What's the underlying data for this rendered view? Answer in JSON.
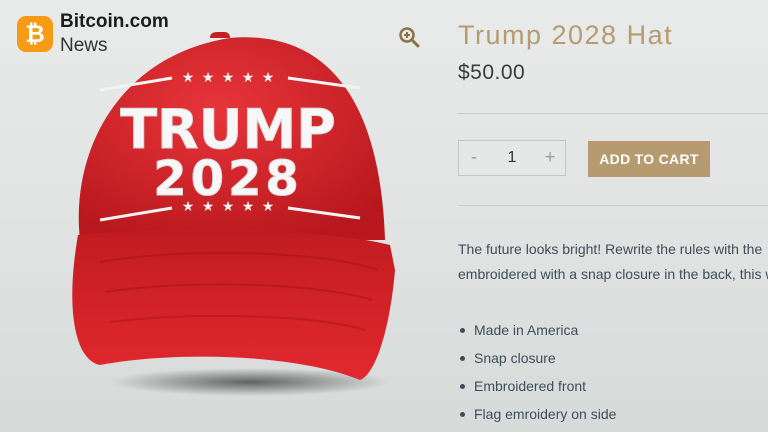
{
  "brand": {
    "icon": "bitcoin-icon",
    "glyph": "₿",
    "name": "Bitcoin.com",
    "sub": "News"
  },
  "product": {
    "title": "Trump 2028 Hat",
    "price": "$50.00",
    "hat_text_line1": "TRUMP",
    "hat_text_line2": "2028",
    "quantity": "1",
    "qty_minus": "-",
    "qty_plus": "+",
    "add_to_cart": "ADD TO CART",
    "description_lines": [
      "The future looks bright! Rewrite the rules with the",
      "embroidered with a snap closure in the back, this w"
    ],
    "features": [
      "Made in America",
      "Snap closure",
      "Embroidered front",
      "Flag emroidery on side"
    ]
  },
  "colors": {
    "accent": "#b59b6f",
    "hat_red": "#d9262a",
    "brand_orange": "#f59b14"
  }
}
